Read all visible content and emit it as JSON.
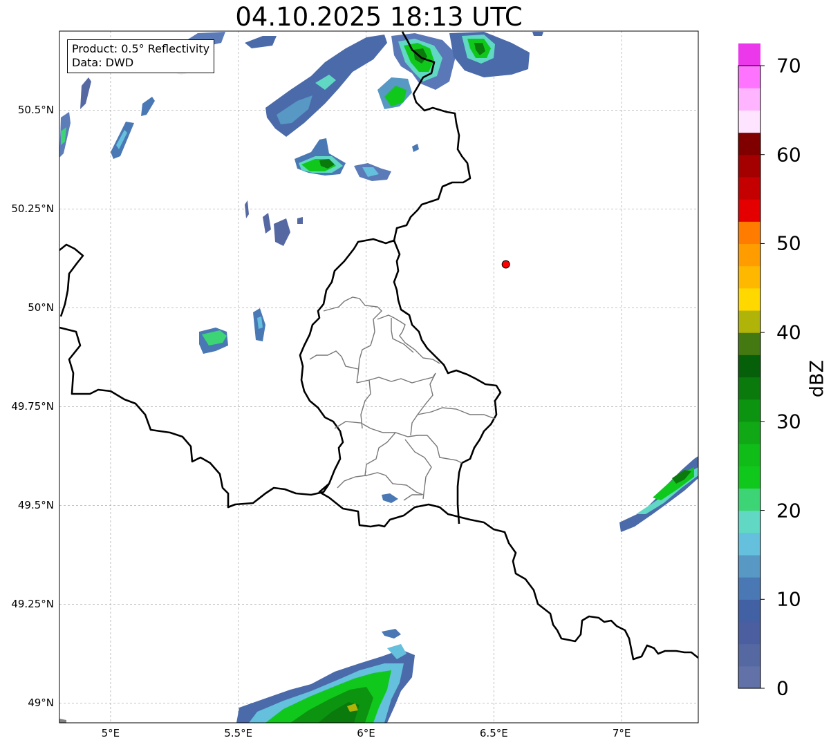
{
  "title": "04.10.2025 18:13 UTC",
  "info": {
    "product": "Product: 0.5° Reflectivity",
    "data": "Data: DWD"
  },
  "map": {
    "lon_range": [
      4.8,
      7.3
    ],
    "lat_range": [
      48.95,
      50.7
    ],
    "lon_ticks": [
      {
        "value": 5.0,
        "label": "5°E"
      },
      {
        "value": 5.5,
        "label": "5.5°E"
      },
      {
        "value": 6.0,
        "label": "6°E"
      },
      {
        "value": 6.5,
        "label": "6.5°E"
      },
      {
        "value": 7.0,
        "label": "7°E"
      }
    ],
    "lat_ticks": [
      {
        "value": 50.5,
        "label": "50.5°N"
      },
      {
        "value": 50.25,
        "label": "50.25°N"
      },
      {
        "value": 50.0,
        "label": "50°N"
      },
      {
        "value": 49.75,
        "label": "49.75°N"
      },
      {
        "value": 49.5,
        "label": "49.5°N"
      },
      {
        "value": 49.25,
        "label": "49.25°N"
      },
      {
        "value": 49.0,
        "label": "49°N"
      }
    ],
    "radar_site": {
      "lon": 6.547,
      "lat": 50.11,
      "color": "#ff0000"
    }
  },
  "colorbar": {
    "label": "dBZ",
    "min": 0,
    "max": 70,
    "ticks": [
      "0",
      "10",
      "20",
      "30",
      "40",
      "50",
      "60",
      "70"
    ],
    "colors": [
      "#6272a8",
      "#5568a2",
      "#4a5ea0",
      "#4260a4",
      "#4a78b4",
      "#5898c4",
      "#64c0dc",
      "#60d8c4",
      "#3cd474",
      "#10c81c",
      "#10bc18",
      "#10a814",
      "#0c9410",
      "#0a7a0c",
      "#06600a",
      "#447810",
      "#b0b408",
      "#ffd800",
      "#ffb800",
      "#ff9c00",
      "#ff7c00",
      "#e40000",
      "#c40000",
      "#a40000",
      "#800000",
      "#ffe4ff",
      "#ffb4ff",
      "#ff74ff",
      "#ea38ea"
    ]
  }
}
